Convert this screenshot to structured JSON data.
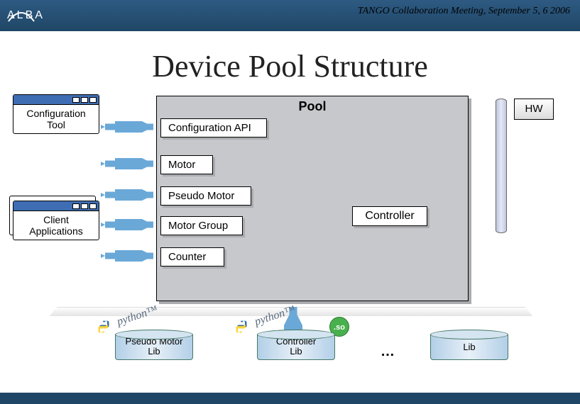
{
  "header": {
    "logo_text": "ALBA",
    "meeting": "TANGO Collaboration Meeting, September 5, 6 2006"
  },
  "title": "Device Pool Structure",
  "pool": {
    "title": "Pool",
    "config_api": "Configuration API",
    "motor": "Motor",
    "pseudo_motor": "Pseudo Motor",
    "motor_group": "Motor Group",
    "counter": "Counter",
    "controller": "Controller"
  },
  "left": {
    "config_tool": "Configuration\nTool",
    "client_apps": "Client\nApplications"
  },
  "hw": "HW",
  "libs": {
    "pseudo_motor_lib": "Pseudo Motor\nLib",
    "controller_lib": "Controller\nLib",
    "lib": "Lib",
    "dots": "…",
    "python": "python™",
    "so": ".so"
  }
}
